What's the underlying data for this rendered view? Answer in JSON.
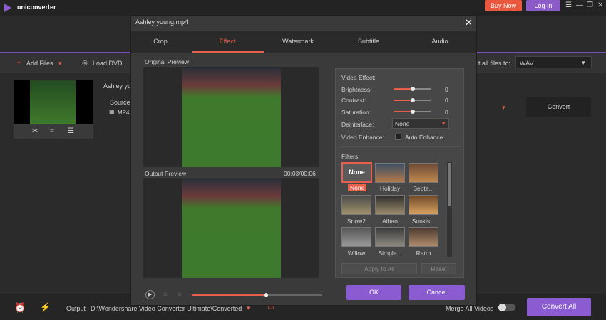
{
  "app": {
    "name": "uniconverter",
    "buy_now": "Buy Now",
    "login": "Log In",
    "win_menu": "☰",
    "win_min": "—",
    "win_max": "❐",
    "win_close": "✕"
  },
  "toolbar": {
    "add_files": "Add Files",
    "load_dvd": "Load DVD",
    "convert_all_to_label": "t all files to:",
    "format": "WAV"
  },
  "file": {
    "name": "Ashley yo",
    "source_label": "Source",
    "source_format": "MP4",
    "convert": "Convert"
  },
  "bottom": {
    "output_label": "Output",
    "output_path": "D:\\Wondershare Video Converter Ultimate\\Converted",
    "merge_label": "Merge All Videos",
    "convert_all": "Convert All"
  },
  "dialog": {
    "title": "Ashley young.mp4",
    "tabs": [
      "Crop",
      "Effect",
      "Watermark",
      "Subtitle",
      "Audio"
    ],
    "active_tab": "Effect",
    "original_preview": "Original Preview",
    "output_preview": "Output Preview",
    "time": "00:03/00:06",
    "playback_progress": 0.57,
    "video_effect": "Video Effect:",
    "brightness": {
      "label": "Brightness:",
      "value": "0"
    },
    "contrast": {
      "label": "Contrast:",
      "value": "0"
    },
    "saturation": {
      "label": "Saturation:",
      "value": "0"
    },
    "deinterlace": {
      "label": "Deinterlace:",
      "value": "None"
    },
    "enhance": {
      "label": "Video Enhance:",
      "checkbox": "Auto Enhance"
    },
    "filters_label": "Filters:",
    "filters": [
      "None",
      "Holiday",
      "Septe...",
      "Snow2",
      "Aibao",
      "Sunkis...",
      "Willow",
      "Simple...",
      "Retro"
    ],
    "apply_all": "Apply to All",
    "reset": "Reset",
    "ok": "OK",
    "cancel": "Cancel"
  },
  "colors": {
    "accent": "#8a5bd1",
    "highlight": "#e8604d",
    "buy_now": "#e9573f"
  }
}
